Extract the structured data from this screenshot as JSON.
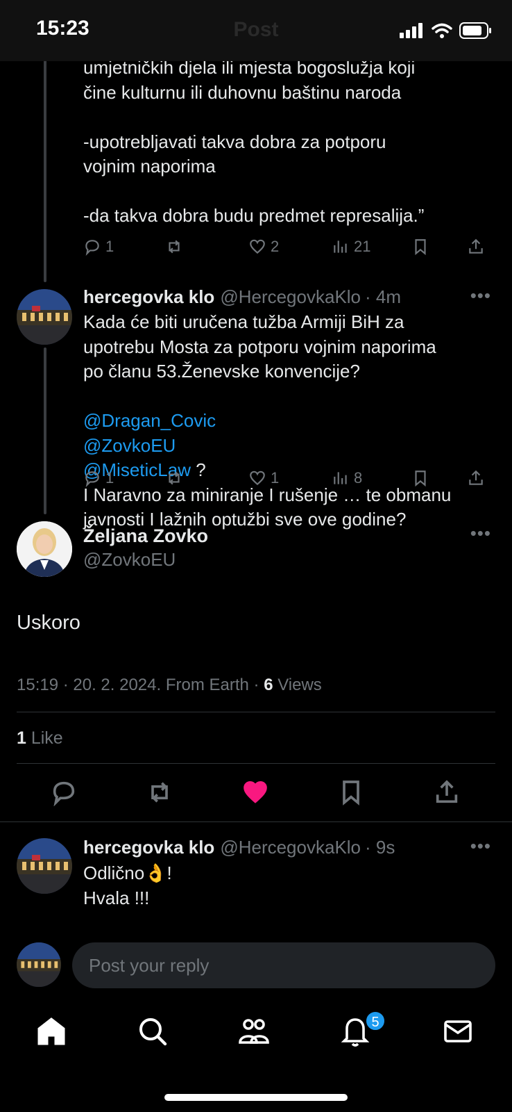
{
  "status": {
    "time": "15:23"
  },
  "header": {
    "title": "Post"
  },
  "thread": {
    "prev_text": "umjetničkih djela ili mjesta bogoslužja koji\nčine kulturnu ili duhovnu baštinu naroda\n\n-upotrebljavati takva dobra za potporu\nvojnim naporima\n\n-da takva dobra budu predmet represalija.”",
    "prev_stats": {
      "replies": "1",
      "likes": "2",
      "views": "21"
    }
  },
  "tweet2": {
    "name": "hercegovka klo",
    "handle": "@HercegovkaKlo",
    "time": "· 4m",
    "text1": "Kada će biti uručena tužba Armiji BiH za\nupotrebu Mosta za potporu vojnim naporima\npo članu 53.Ženevske konvencije?",
    "mention1": "@Dragan_Covic",
    "mention2": "@ZovkoEU",
    "mention3": "@MiseticLaw",
    "mention_tail": " ?",
    "text2": "I Naravno za miniranje I rušenje … te obmanu\njavnosti I lažnih optužbi sve ove godine?",
    "stats": {
      "replies": "1",
      "likes": "1",
      "views": "8"
    }
  },
  "main": {
    "name": "Željana Zovko",
    "handle": "@ZovkoEU",
    "text": "Uskoro",
    "meta_prefix": "15:19 · 20. 2. 2024. From Earth · ",
    "views_count": "6",
    "views_label": " Views",
    "likes_count": "1",
    "likes_label": " Like"
  },
  "reply": {
    "name": "hercegovka klo",
    "handle": "@HercegovkaKlo",
    "time": "· 9s",
    "line1": "Odlično",
    "emoji": "👌",
    "line1_tail": "!",
    "line2": "Hvala !!!"
  },
  "composer": {
    "placeholder": "Post your reply"
  },
  "tabs": {
    "notifications_badge": "5"
  },
  "colors": {
    "accent": "#1d9bf0",
    "like": "#f91880",
    "text": "#e7e9ea",
    "muted": "#71767b"
  }
}
